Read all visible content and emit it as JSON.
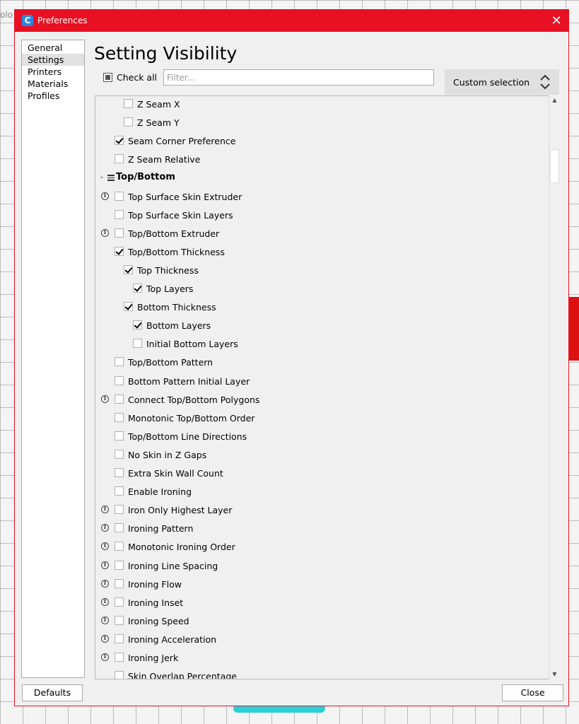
{
  "background": {
    "label": "olo"
  },
  "window": {
    "title": "Preferences",
    "close_glyph": "✕",
    "icon_letter": "C",
    "accent": "#e81123"
  },
  "sidebar": {
    "items": [
      {
        "label": "General",
        "active": false
      },
      {
        "label": "Settings",
        "active": true
      },
      {
        "label": "Printers",
        "active": false
      },
      {
        "label": "Materials",
        "active": false
      },
      {
        "label": "Profiles",
        "active": false
      }
    ]
  },
  "main": {
    "heading": "Setting Visibility",
    "check_all_label": "Check all",
    "filter_placeholder": "Filter...",
    "filter_value": "",
    "preset_selected": "Custom selection"
  },
  "settings": [
    {
      "label": "Z Seam X",
      "checked": false,
      "level": 2,
      "info": false
    },
    {
      "label": "Z Seam Y",
      "checked": false,
      "level": 2,
      "info": false
    },
    {
      "label": "Seam Corner Preference",
      "checked": true,
      "level": 1,
      "info": false
    },
    {
      "label": "Z Seam Relative",
      "checked": false,
      "level": 1,
      "info": false
    },
    {
      "label": "Top/Bottom",
      "category": true,
      "icon": "layers-icon"
    },
    {
      "label": "Top Surface Skin Extruder",
      "checked": false,
      "level": 1,
      "info": true
    },
    {
      "label": "Top Surface Skin Layers",
      "checked": false,
      "level": 1,
      "info": false
    },
    {
      "label": "Top/Bottom Extruder",
      "checked": false,
      "level": 1,
      "info": true
    },
    {
      "label": "Top/Bottom Thickness",
      "checked": true,
      "level": 1,
      "info": false
    },
    {
      "label": "Top Thickness",
      "checked": true,
      "level": 2,
      "info": false
    },
    {
      "label": "Top Layers",
      "checked": true,
      "level": 3,
      "info": false
    },
    {
      "label": "Bottom Thickness",
      "checked": true,
      "level": 2,
      "info": false
    },
    {
      "label": "Bottom Layers",
      "checked": true,
      "level": 3,
      "info": false
    },
    {
      "label": "Initial Bottom Layers",
      "checked": false,
      "level": 3,
      "info": false
    },
    {
      "label": "Top/Bottom Pattern",
      "checked": false,
      "level": 1,
      "info": false
    },
    {
      "label": "Bottom Pattern Initial Layer",
      "checked": false,
      "level": 1,
      "info": false
    },
    {
      "label": "Connect Top/Bottom Polygons",
      "checked": false,
      "level": 1,
      "info": true
    },
    {
      "label": "Monotonic Top/Bottom Order",
      "checked": false,
      "level": 1,
      "info": false
    },
    {
      "label": "Top/Bottom Line Directions",
      "checked": false,
      "level": 1,
      "info": false
    },
    {
      "label": "No Skin in Z Gaps",
      "checked": false,
      "level": 1,
      "info": false
    },
    {
      "label": "Extra Skin Wall Count",
      "checked": false,
      "level": 1,
      "info": false
    },
    {
      "label": "Enable Ironing",
      "checked": false,
      "level": 1,
      "info": false
    },
    {
      "label": "Iron Only Highest Layer",
      "checked": false,
      "level": 1,
      "info": true
    },
    {
      "label": "Ironing Pattern",
      "checked": false,
      "level": 1,
      "info": true
    },
    {
      "label": "Monotonic Ironing Order",
      "checked": false,
      "level": 1,
      "info": true
    },
    {
      "label": "Ironing Line Spacing",
      "checked": false,
      "level": 1,
      "info": true
    },
    {
      "label": "Ironing Flow",
      "checked": false,
      "level": 1,
      "info": true
    },
    {
      "label": "Ironing Inset",
      "checked": false,
      "level": 1,
      "info": true
    },
    {
      "label": "Ironing Speed",
      "checked": false,
      "level": 1,
      "info": true
    },
    {
      "label": "Ironing Acceleration",
      "checked": false,
      "level": 1,
      "info": true
    },
    {
      "label": "Ironing Jerk",
      "checked": false,
      "level": 1,
      "info": true
    },
    {
      "label": "Skin Overlap Percentage",
      "checked": false,
      "level": 1,
      "info": false
    }
  ],
  "footer": {
    "defaults_label": "Defaults",
    "close_label": "Close"
  }
}
